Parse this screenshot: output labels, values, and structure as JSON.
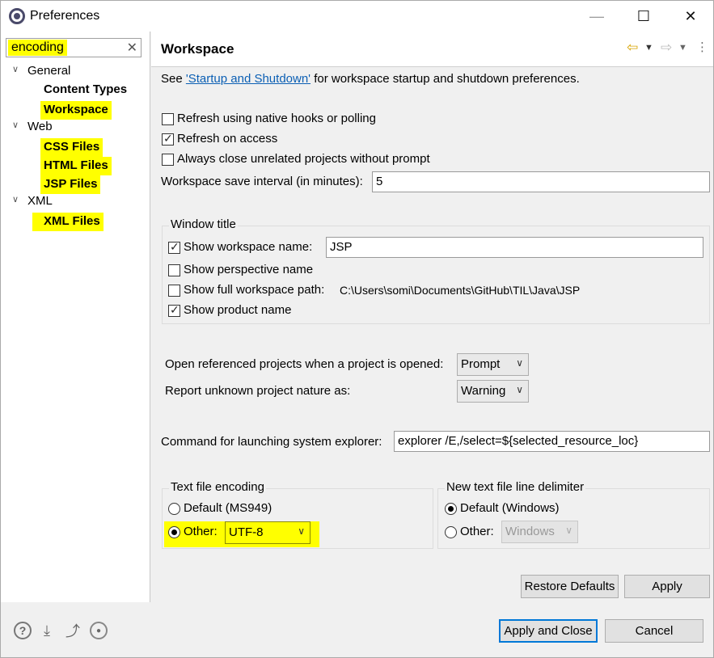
{
  "window": {
    "title": "Preferences"
  },
  "filter": {
    "value": "encoding"
  },
  "tree": [
    {
      "label": "General",
      "type": "category"
    },
    {
      "label": "Content Types",
      "type": "leaf"
    },
    {
      "label": "Workspace",
      "type": "leaf"
    },
    {
      "label": "Web",
      "type": "category"
    },
    {
      "label": "CSS Files",
      "type": "leaf"
    },
    {
      "label": "HTML Files",
      "type": "leaf"
    },
    {
      "label": "JSP Files",
      "type": "leaf"
    },
    {
      "label": "XML",
      "type": "category"
    },
    {
      "label": "XML Files",
      "type": "leaf"
    }
  ],
  "page": {
    "title": "Workspace",
    "see_prefix": "See",
    "see_link": "'Startup and Shutdown'",
    "see_suffix": "for workspace startup and shutdown preferences.",
    "refresh_native": "Refresh using native hooks or polling",
    "refresh_access": "Refresh on access",
    "always_close": "Always close unrelated projects without prompt",
    "save_interval_label": "Workspace save interval (in minutes):",
    "save_interval_value": "5",
    "window_title_group": "Window title",
    "show_ws_name": "Show workspace name:",
    "ws_name_value": "JSP",
    "show_perspective": "Show perspective name",
    "show_full_path": "Show full workspace path:",
    "full_path_value": "C:\\Users\\somi\\Documents\\GitHub\\TIL\\Java\\JSP",
    "show_product": "Show product name",
    "open_ref_label": "Open referenced projects when a project is opened:",
    "open_ref_value": "Prompt",
    "report_unknown_label": "Report unknown project nature as:",
    "report_unknown_value": "Warning",
    "explorer_label": "Command for launching system explorer:",
    "explorer_value": "explorer /E,/select=${selected_resource_loc}",
    "encoding_group": "Text file encoding",
    "encoding_default": "Default (MS949)",
    "encoding_other": "Other:",
    "encoding_other_value": "UTF-8",
    "delimiter_group": "New text file line delimiter",
    "delimiter_default": "Default (Windows)",
    "delimiter_other": "Other:",
    "delimiter_other_value": "Windows"
  },
  "buttons": {
    "restore_defaults": "Restore Defaults",
    "apply": "Apply",
    "apply_close": "Apply and Close",
    "cancel": "Cancel"
  },
  "icons": [
    "help-icon",
    "import-icon",
    "export-icon",
    "record-icon"
  ],
  "colors": {
    "highlight": "#ffff00",
    "link": "#0b5fb4",
    "focus": "#0078d7"
  }
}
